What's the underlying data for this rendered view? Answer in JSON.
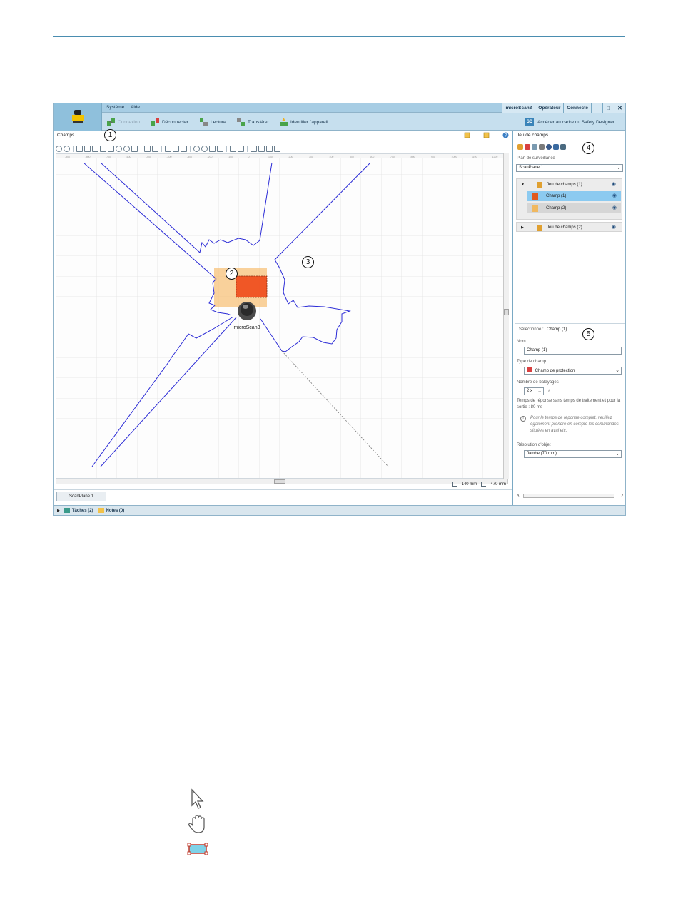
{
  "menu": {
    "items": [
      "Système",
      "Aide"
    ]
  },
  "window": {
    "device": "microScan3",
    "role": "Opérateur",
    "status": "Connecté",
    "minimize": "—",
    "maximize": "□",
    "close": "✕"
  },
  "toolbar": {
    "connect_label": "Connexion",
    "disconnect_label": "Déconnecter",
    "read_label": "Lecture",
    "transfer_label": "Transférer",
    "identify_label": "Identifier l'appareil",
    "safety_designer_badge": "SD",
    "safety_designer_label": "Accéder au cadre du Safety Designer"
  },
  "left_panel": {
    "title": "Champs",
    "device_label": "microScan3",
    "coord_x": "140 mm",
    "coord_y": "470 mm",
    "tab": "ScanPlane 1",
    "ruler_ticks": [
      "-900",
      "-800",
      "-700",
      "-600",
      "-500",
      "-400",
      "-300",
      "-200",
      "-100",
      "0",
      "100",
      "200",
      "300",
      "400",
      "500",
      "600",
      "700",
      "800",
      "900",
      "1000",
      "1100",
      "1200"
    ]
  },
  "right_panel": {
    "title": "Jeu de champs",
    "plan_label": "Plan de surveillance",
    "plan_value": "ScanPlane 1",
    "tree": [
      {
        "label": "Jeu de champs (1)",
        "level": 0,
        "expanded": true,
        "color": "#e0a030"
      },
      {
        "label": "Champ (1)",
        "level": 1,
        "selected": true,
        "color": "#e05a1e"
      },
      {
        "label": "Champ (2)",
        "level": 1,
        "color": "#f0b860"
      }
    ],
    "tree2": {
      "label": "Jeu de champs (2)",
      "color": "#e0a030"
    },
    "selected_label": "Sélectionné :",
    "selected_value": "Champ (1)",
    "name_label": "Nom",
    "name_value": "Champ (1)",
    "field_type_label": "Type de champ",
    "field_type_value": "Champ de protection",
    "scans_label": "Nombre de balayages",
    "scans_value": "2 x",
    "response_text": "Temps de réponse sans temps de traitement et pour la sortie : 80 ms",
    "info_icon": "i",
    "info_text": "Pour le temps de réponse complet, veuillez également prendre en compte les commandes situées en aval etc.",
    "resolution_label": "Résolution d'objet",
    "resolution_value": "Jambe (70 mm)"
  },
  "statusbar": {
    "tasks": "Tâches (2)",
    "notes": "Notes (0)"
  },
  "callouts": [
    "1",
    "2",
    "3",
    "4",
    "5"
  ],
  "legend_icons": [
    "select-pointer-icon",
    "pan-hand-icon",
    "rectangle-field-icon"
  ],
  "colors": {
    "accent": "#4a8db0",
    "header": "#c6dfee",
    "protective_field": "#f04a1a",
    "warning_field": "#f7c27a",
    "contour": "#2b2bd6",
    "selection": "#8ccaf0"
  }
}
